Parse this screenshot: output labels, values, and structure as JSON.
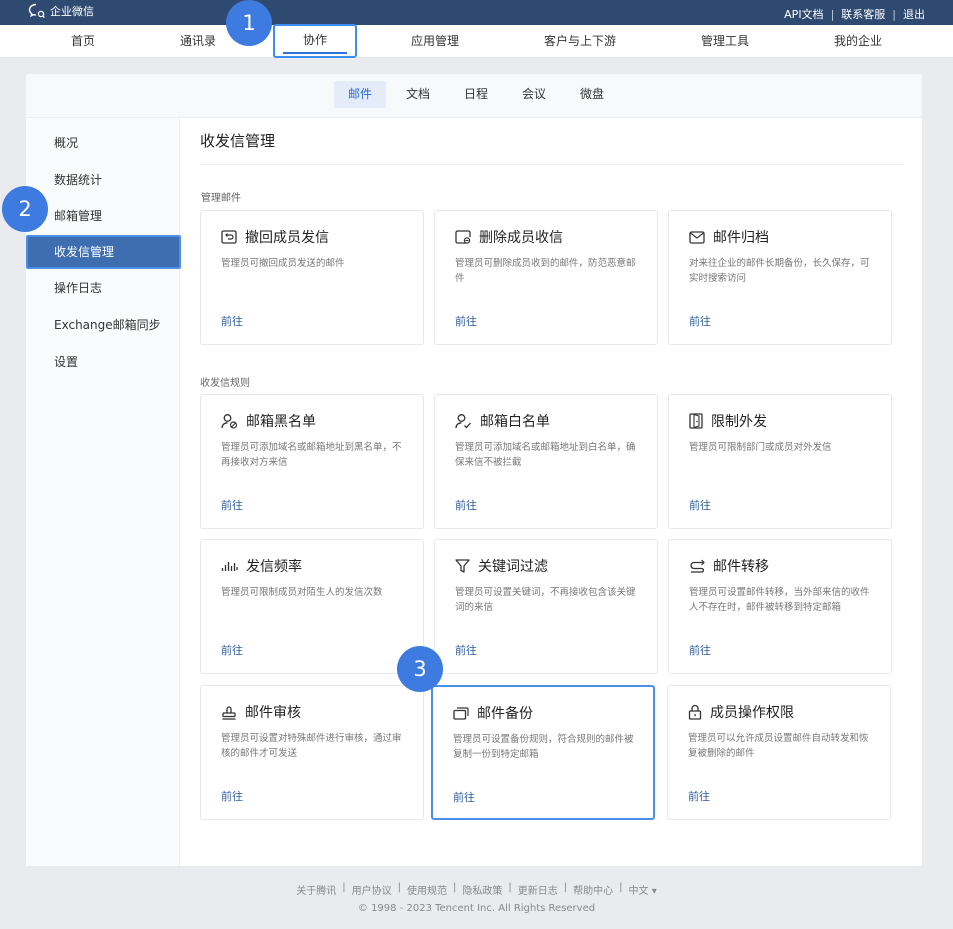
{
  "topbar": {
    "app_name": "企业微信",
    "links": [
      "API文档",
      "联系客服",
      "退出"
    ]
  },
  "mainnav": {
    "items": [
      "首页",
      "通讯录",
      "协作",
      "应用管理",
      "客户与上下游",
      "管理工具",
      "我的企业"
    ],
    "active": "协作"
  },
  "subnav": {
    "tabs": [
      "邮件",
      "文档",
      "日程",
      "会议",
      "微盘"
    ],
    "active": "邮件"
  },
  "sidebar": {
    "items": [
      "概况",
      "数据统计",
      "邮箱管理",
      "收发信管理",
      "操作日志",
      "Exchange邮箱同步",
      "设置"
    ],
    "active": "收发信管理"
  },
  "main": {
    "title": "收发信管理",
    "sections": [
      {
        "label": "管理邮件",
        "cards": [
          {
            "icon": "recall-icon",
            "title": "撤回成员发信",
            "desc": "管理员可撤回成员发送的邮件",
            "link": "前往"
          },
          {
            "icon": "delete-mail-icon",
            "title": "删除成员收信",
            "desc": "管理员可删除成员收到的邮件，防范恶意邮件",
            "link": "前往"
          },
          {
            "icon": "mail-icon",
            "title": "邮件归档",
            "desc": "对来往企业的邮件长期备份，长久保存，可实时搜索访问",
            "link": "前往"
          }
        ]
      },
      {
        "label": "收发信规则",
        "cards": [
          {
            "icon": "user-block-icon",
            "title": "邮箱黑名单",
            "desc": "管理员可添加域名或邮箱地址到黑名单，不再接收对方来信",
            "link": "前往"
          },
          {
            "icon": "user-allow-icon",
            "title": "邮箱白名单",
            "desc": "管理员可添加域名或邮箱地址到白名单，确保来信不被拦截",
            "link": "前往"
          },
          {
            "icon": "door-exit-icon",
            "title": "限制外发",
            "desc": "管理员可限制部门或成员对外发信",
            "link": "前往"
          },
          {
            "icon": "frequency-icon",
            "title": "发信频率",
            "desc": "管理员可限制成员对陌生人的发信次数",
            "link": "前往"
          },
          {
            "icon": "filter-icon",
            "title": "关键词过滤",
            "desc": "管理员可设置关键词，不再接收包含该关键词的来信",
            "link": "前往"
          },
          {
            "icon": "forward-icon",
            "title": "邮件转移",
            "desc": "管理员可设置邮件转移，当外部来信的收件人不存在时，邮件被转移到特定邮箱",
            "link": "前往"
          },
          {
            "icon": "stamp-icon",
            "title": "邮件审核",
            "desc": "管理员可设置对特殊邮件进行审核，通过审核的邮件才可发送",
            "link": "前往"
          },
          {
            "icon": "backup-icon",
            "title": "邮件备份",
            "desc": "管理员可设置备份规则，符合规则的邮件被复制一份到特定邮箱",
            "link": "前往"
          },
          {
            "icon": "lock-icon",
            "title": "成员操作权限",
            "desc": "管理员可以允许成员设置邮件自动转发和恢复被删除的邮件",
            "link": "前往"
          }
        ]
      }
    ]
  },
  "badges": [
    "1",
    "2",
    "3"
  ],
  "footer": {
    "links": [
      "关于腾讯",
      "用户协议",
      "使用规范",
      "隐私政策",
      "更新日志",
      "帮助中心",
      "中文 ▾"
    ],
    "copyright": "© 1998 - 2023 Tencent Inc. All Rights Reserved"
  },
  "colors": {
    "topbar": "#2f4a70",
    "accent": "#3d7be0",
    "link": "#2f5d9c",
    "sidebar_active": "#3e6eb0"
  }
}
